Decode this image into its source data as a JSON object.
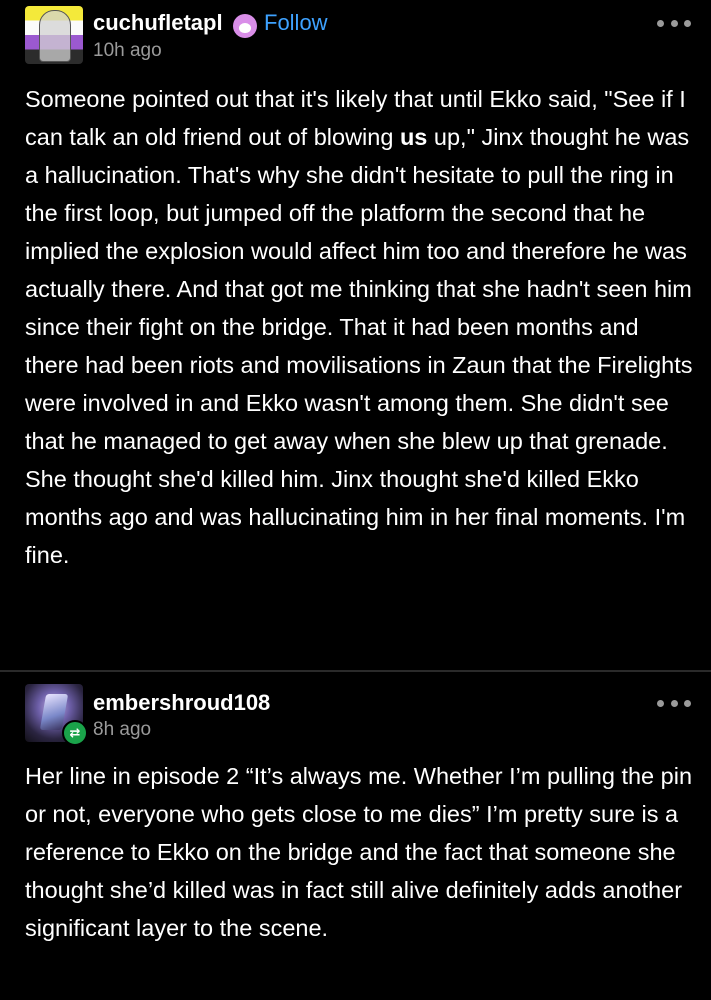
{
  "posts": [
    {
      "username": "cuchufletapl",
      "follow_label": "Follow",
      "timestamp": "10h ago",
      "avatar_icon": "nonbinary-flag-avatar",
      "badge_icon": "paw-badge-icon",
      "text_before_bold": "Someone pointed out that it's likely that until Ekko said, \"See if I can talk an old friend out of blowing ",
      "text_bold": "us",
      "text_after_bold": " up,\" Jinx thought he was a hallucination. That's why she didn't hesitate to pull the ring in the first loop, but jumped off the platform the second that he implied the explosion would affect him too and therefore he was actually there. And that got me thinking that she hadn't seen him since their fight on the bridge. That it had been months and there had been riots and movilisations in Zaun that the Firelights were involved in and Ekko wasn't among them. She didn't see that he managed to get away when she blew up that grenade. She thought she'd killed him. Jinx thought she'd killed Ekko months ago and was hallucinating him in her final moments. I'm fine."
    },
    {
      "username": "embershroud108",
      "timestamp": "8h ago",
      "avatar_icon": "crystal-avatar",
      "badge_icon": "reblog-icon",
      "text": "Her line in episode 2 “It’s always me. Whether I’m pulling the pin or not, everyone who gets close to me dies” I’m pretty sure is a reference to Ekko on the bridge and the fact that someone she thought she’d killed was in fact still alive definitely adds another significant layer to the scene."
    }
  ],
  "colors": {
    "background": "#000000",
    "text": "#ffffff",
    "muted": "#9a9a9a",
    "link": "#3ea2ff",
    "reblog_green": "#1aa34a",
    "badge_pink": "#d98ee8"
  }
}
